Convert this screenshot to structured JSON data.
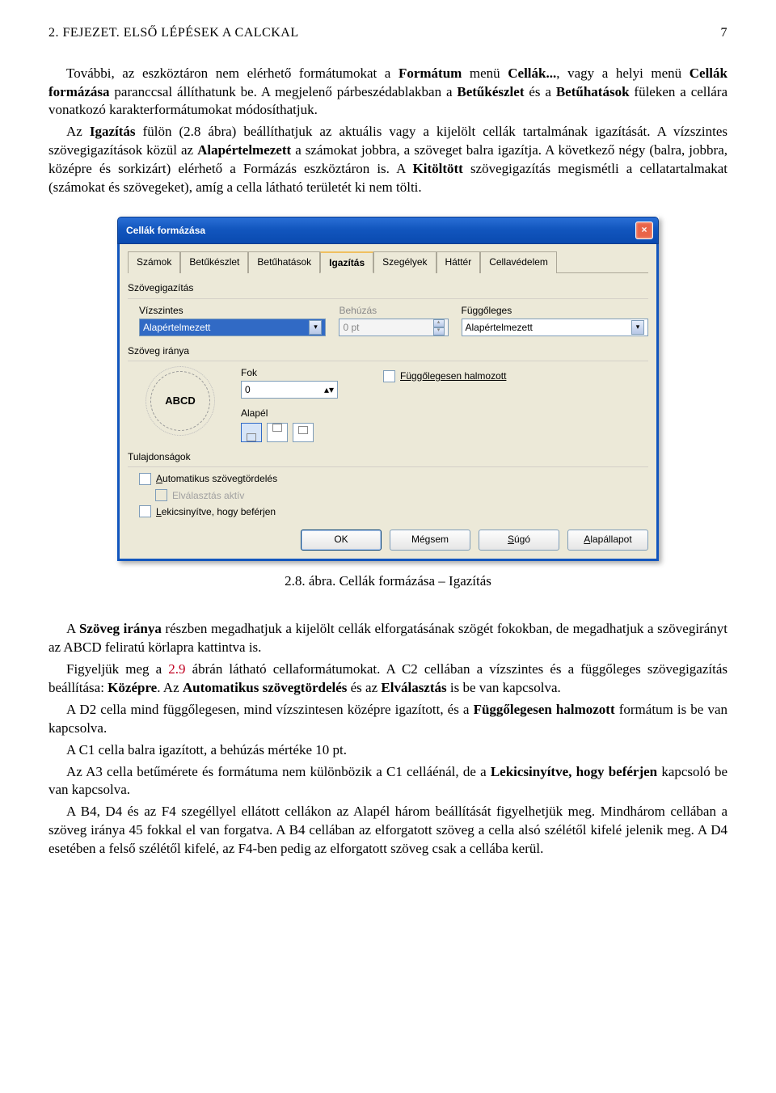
{
  "header": {
    "left": "2. FEJEZET. ELSŐ LÉPÉSEK A CALCKAL",
    "right": "7"
  },
  "p1a": "További, az eszköztáron nem elérhető formátumokat a ",
  "p1b": "Formátum",
  "p1c": " menü ",
  "p1d": "Cellák...",
  "p1e": ", vagy a helyi menü ",
  "p1f": "Cellák formázása",
  "p1g": " paranccsal állíthatunk be. A megjelenő párbeszédablakban a ",
  "p1h": "Betűkészlet",
  "p1i": " és a ",
  "p1j": "Betűhatások",
  "p1k": " füleken a cellára vonatkozó karakterformátumokat módosíthatjuk.",
  "p2a": "Az ",
  "p2b": "Igazítás",
  "p2c": " fülön (2.8 ábra) beállíthatjuk az aktuális vagy a kijelölt cellák tartalmának igazítását. A vízszintes szövegigazítások közül az ",
  "p2d": "Alapértelmezett",
  "p2e": " a számokat jobbra, a szöveget balra igazítja. A következő négy (balra, jobbra, középre és sorkizárt) elérhető a Formázás eszköztáron is. A ",
  "p2f": "Kitöltött",
  "p2g": " szövegigazítás megismétli a cellatartalmakat (számokat és szövegeket), amíg a cella látható területét ki nem tölti.",
  "dialog": {
    "title": "Cellák formázása",
    "tabs": [
      "Számok",
      "Betűkészlet",
      "Betűhatások",
      "Igazítás",
      "Szegélyek",
      "Háttér",
      "Cellavédelem"
    ],
    "active_tab": "Igazítás",
    "group_align": "Szövegigazítás",
    "horiz_label": "Vízszintes",
    "horiz_value": "Alapértelmezett",
    "indent_label": "Behúzás",
    "indent_value": "0 pt",
    "vert_label": "Függőleges",
    "vert_value": "Alapértelmezett",
    "group_dir": "Szöveg iránya",
    "deg_label": "Fok",
    "deg_value": "0",
    "stacked_label": "Függőlegesen halmozott",
    "abcd": "ABCD",
    "refedge_label": "Alapél",
    "group_props": "Tulajdonságok",
    "wrap_label": "Automatikus szövegtördelés",
    "hyphen_label": "Elválasztás aktív",
    "shrink_label": "Lekicsinyítve, hogy beférjen",
    "btn_ok": "OK",
    "btn_cancel": "Mégsem",
    "btn_help": "Súgó",
    "btn_reset": "Alapállapot"
  },
  "caption": "2.8. ábra. Cellák formázása – Igazítás",
  "p3a": "A ",
  "p3b": "Szöveg iránya",
  "p3c": " részben megadhatjuk a kijelölt cellák elforgatásának szögét fokokban, de megadhatjuk a szövegirányt az ABCD feliratú körlapra kattintva is.",
  "p4a": "Figyeljük meg a ",
  "p4link": "2.9",
  "p4b": " ábrán látható cellaformátumokat. A C2 cellában a vízszintes és a függőleges szövegigazítás beállítása: ",
  "p4c": "Középre",
  "p4d": ". Az ",
  "p4e": "Automatikus szövegtördelés",
  "p4f": " és az ",
  "p4g": "Elválasztás",
  "p4h": " is be van kapcsolva.",
  "p5a": "A D2 cella mind függőlegesen, mind vízszintesen középre igazított, és a ",
  "p5b": "Függőlegesen halmozott",
  "p5c": " formátum is be van kapcsolva.",
  "p6": "A C1 cella balra igazított, a behúzás mértéke 10 pt.",
  "p7a": "Az A3 cella betűmérete és formátuma nem különbözik a C1 celláénál, de a ",
  "p7b": "Lekicsinyítve, hogy beférjen",
  "p7c": " kapcsoló be van kapcsolva.",
  "p8": "A B4, D4 és az F4 szegéllyel ellátott cellákon az Alapél három beállítását figyelhetjük meg. Mindhárom cellában a szöveg iránya 45 fokkal el van forgatva. A B4 cellában az elforgatott szöveg a cella alsó szélétől kifelé jelenik meg. A D4 esetében a felső szélétől kifelé, az F4-ben pedig az elforgatott szöveg csak a cellába kerül."
}
